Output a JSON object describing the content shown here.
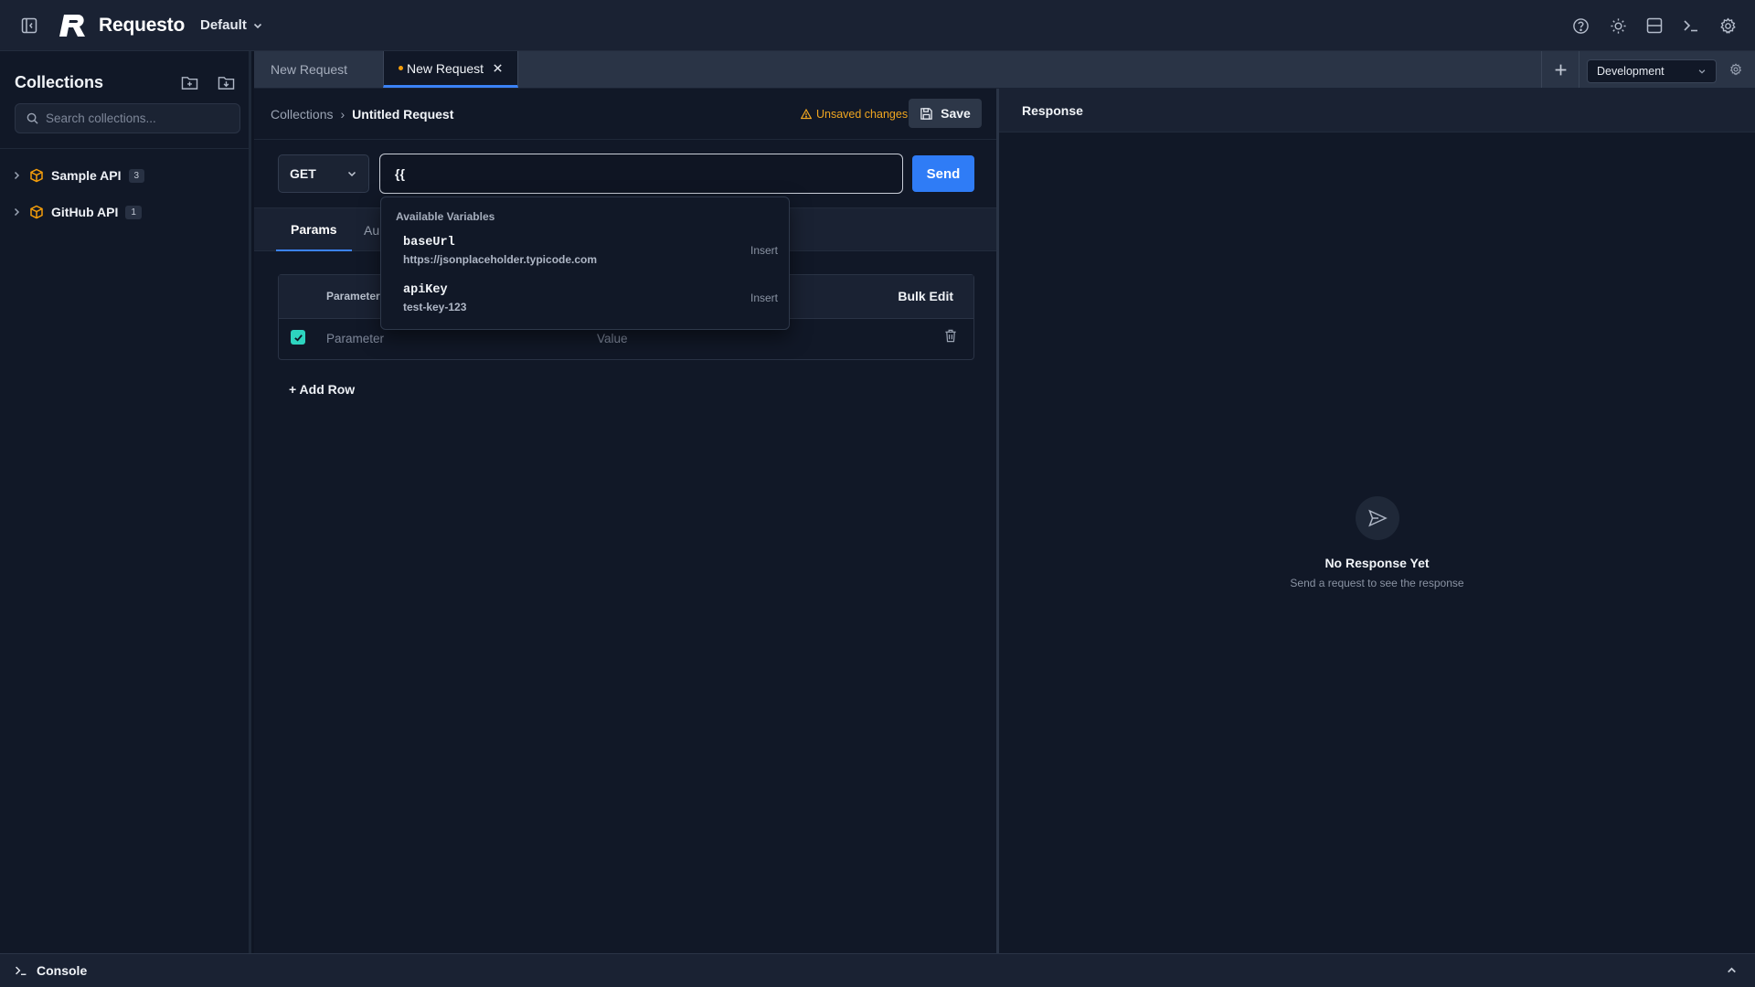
{
  "app": {
    "name": "Requesto",
    "workspace": "Default"
  },
  "sidebar": {
    "title": "Collections",
    "search_placeholder": "Search collections...",
    "collections": [
      {
        "name": "Sample API",
        "count": "3"
      },
      {
        "name": "GitHub API",
        "count": "1"
      }
    ]
  },
  "tabs": [
    {
      "label": "New Request",
      "active": false
    },
    {
      "label": "New Request",
      "active": true,
      "unsaved": true
    }
  ],
  "environment": {
    "selected": "Development"
  },
  "request": {
    "breadcrumb_root": "Collections",
    "breadcrumb_separator": "›",
    "title": "Untitled Request",
    "unsaved_label": "Unsaved changes",
    "save_label": "Save",
    "method": "GET",
    "url": "{{",
    "send_label": "Send",
    "subtabs": {
      "params": "Params",
      "partial": "Au"
    },
    "params_table": {
      "header_param": "Parameter",
      "bulk_edit": "Bulk Edit",
      "row_param_placeholder": "Parameter",
      "row_value_placeholder": "Value",
      "row_checked": true
    },
    "add_row": "+ Add Row"
  },
  "autocomplete": {
    "title": "Available Variables",
    "items": [
      {
        "name": "baseUrl",
        "value": "https://jsonplaceholder.typicode.com",
        "action": "Insert"
      },
      {
        "name": "apiKey",
        "value": "test-key-123",
        "action": "Insert"
      }
    ]
  },
  "response": {
    "title": "Response",
    "empty_title": "No Response Yet",
    "empty_subtitle": "Send a request to see the response"
  },
  "console": {
    "label": "Console"
  },
  "colors": {
    "accent": "#2f7cf6",
    "warning": "#f0a620",
    "brand_icon": "#f59e0b",
    "checkbox": "#2dd4bf"
  }
}
